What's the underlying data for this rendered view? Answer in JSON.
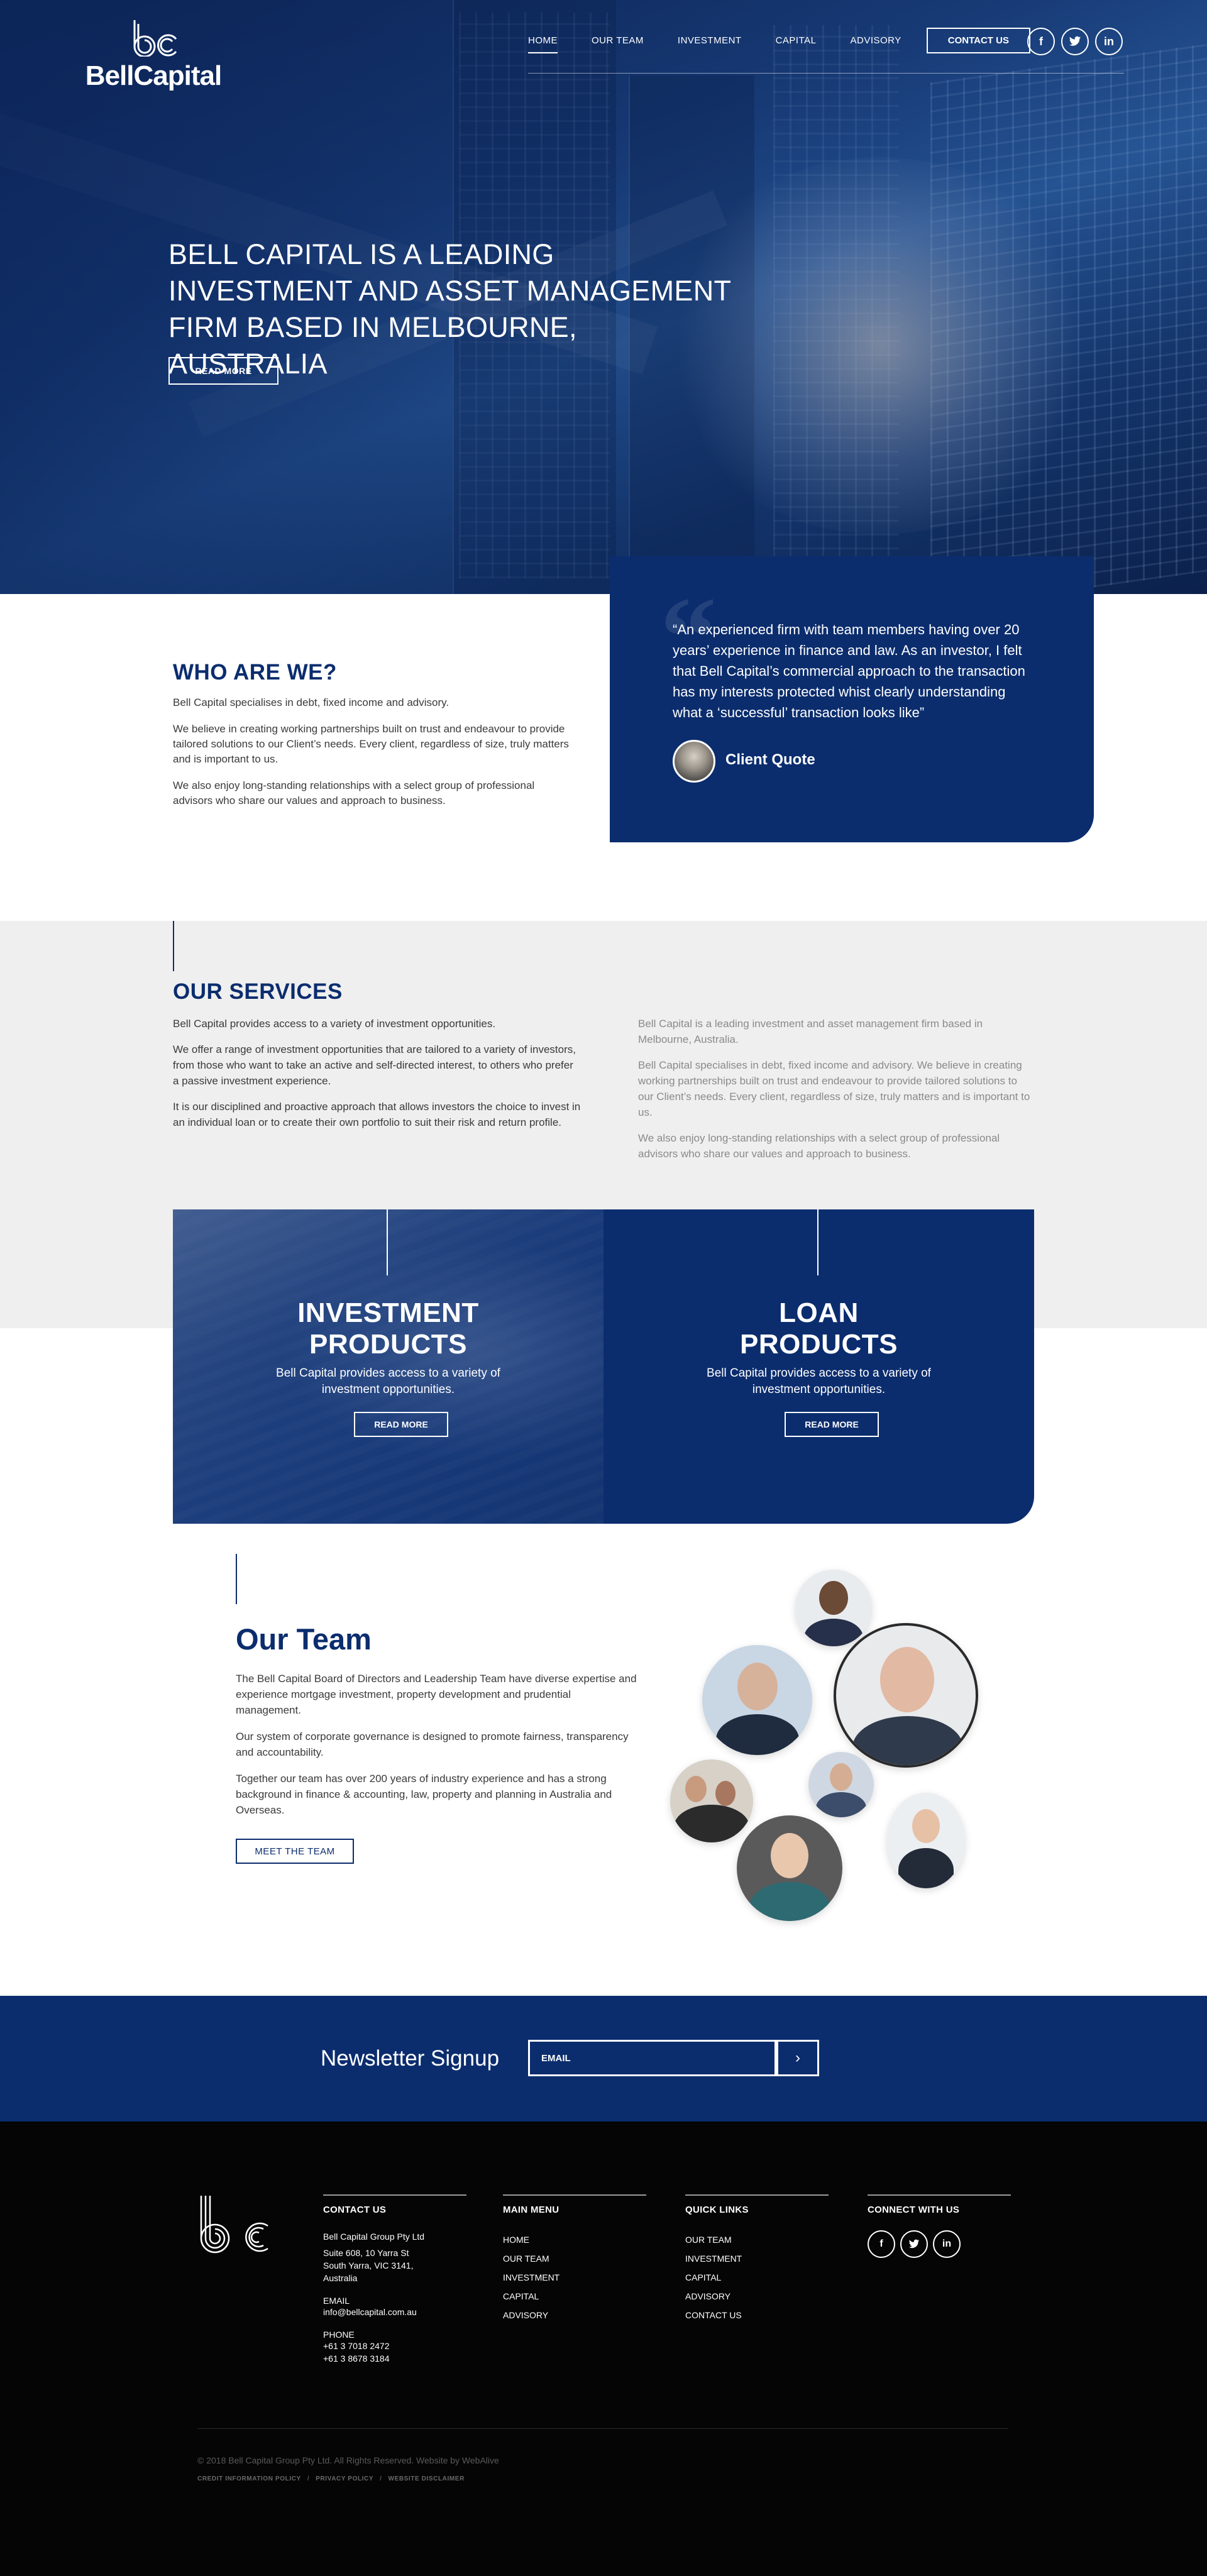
{
  "brand": {
    "name": "BellCapital",
    "mark": "bc"
  },
  "nav": {
    "items": [
      "HOME",
      "OUR TEAM",
      "INVESTMENT",
      "CAPITAL",
      "ADVISORY"
    ],
    "contact": "CONTACT US"
  },
  "social": {
    "facebook": "f",
    "twitter": "t",
    "linkedin": "in"
  },
  "hero": {
    "title": "BELL CAPITAL IS A LEADING INVESTMENT AND ASSET MANAGEMENT FIRM BASED IN MELBOURNE, AUSTRALIA",
    "button": "READ MORE"
  },
  "who": {
    "title": "WHO ARE WE?",
    "paragraphs": [
      "Bell Capital specialises in debt, fixed income and advisory.",
      "We believe in creating working partnerships built on trust and endeavour to provide tailored solutions to our Client’s needs. Every client, regardless of size, truly matters and is important to us.",
      "We also enjoy long-standing relationships with a select group of professional advisors who share our values and approach to business."
    ]
  },
  "quote": {
    "text": "“An experienced firm with team members having over 20 years’ experience in finance and law. As an investor, I felt that Bell Capital’s commercial approach to the transaction has my interests protected whist clearly understanding what a ‘successful’ transaction looks like”",
    "author": "Client Quote"
  },
  "services": {
    "title": "OUR SERVICES",
    "left": [
      "Bell Capital provides access to a variety of investment opportunities.",
      "We offer a range of investment opportunities that are tailored to a variety of investors, from those who want to take an active and self-directed interest, to others who prefer a passive investment experience.",
      "It is our disciplined and proactive approach that allows investors the choice to invest in an individual loan or to create their own portfolio to suit their risk and return profile."
    ],
    "right": [
      "Bell Capital is a leading investment and asset management firm based in Melbourne, Australia.",
      "Bell Capital specialises in debt, fixed income and advisory. We believe in creating working partnerships built on trust and endeavour to provide tailored solutions to our Client’s needs. Every client, regardless of size, truly matters and is important to us.",
      "We also enjoy long-standing relationships with a select group of professional advisors who share our values and approach to business."
    ]
  },
  "cards": [
    {
      "title_line1": "INVESTMENT",
      "title_line2": "PRODUCTS",
      "desc": "Bell Capital provides access to a variety of investment opportunities.",
      "button": "READ MORE"
    },
    {
      "title_line1": "LOAN",
      "title_line2": "PRODUCTS",
      "desc": "Bell Capital provides access to a variety of investment opportunities.",
      "button": "READ MORE"
    }
  ],
  "team": {
    "title": "Our Team",
    "paragraphs": [
      "The Bell Capital Board of Directors and Leadership Team have diverse expertise and experience mortgage investment, property development and prudential management.",
      "Our system of corporate governance is designed to promote fairness, transparency and accountability.",
      "Together our team has over 200 years of industry experience and has a strong background in finance & accounting, law, property and planning in Australia and Overseas."
    ],
    "button": "MEET THE TEAM"
  },
  "newsletter": {
    "title": "Newsletter Signup",
    "placeholder": "EMAIL",
    "submit": "›"
  },
  "footer": {
    "contact": {
      "heading": "CONTACT US",
      "company": "Bell Capital Group Pty Ltd",
      "address": [
        "Suite 608, 10 Yarra St",
        "South Yarra, VIC 3141,",
        "Australia"
      ],
      "email_label": "EMAIL",
      "email": "info@bellcapital.com.au",
      "phone_label": "PHONE",
      "phones": [
        "+61 3 7018 2472",
        "+61 3 8678 3184"
      ]
    },
    "main_menu": {
      "heading": "MAIN MENU",
      "items": [
        "HOME",
        "OUR TEAM",
        "INVESTMENT",
        "CAPITAL",
        "ADVISORY"
      ]
    },
    "quick_links": {
      "heading": "QUICK LINKS",
      "items": [
        "OUR TEAM",
        "INVESTMENT",
        "CAPITAL",
        "ADVISORY",
        "CONTACT US"
      ]
    },
    "connect": {
      "heading": "CONNECT WITH US"
    },
    "copyright": "© 2018 Bell Capital Group Pty Ltd. All Rights Reserved. Website by WebAlive",
    "policies": [
      "CREDIT INFORMATION POLICY",
      "PRIVACY POLICY",
      "WEBSITE DISCLAIMER"
    ]
  },
  "colors": {
    "brand_navy": "#0b2d6e",
    "light_gray": "#efefef",
    "footer_black": "#050505"
  }
}
